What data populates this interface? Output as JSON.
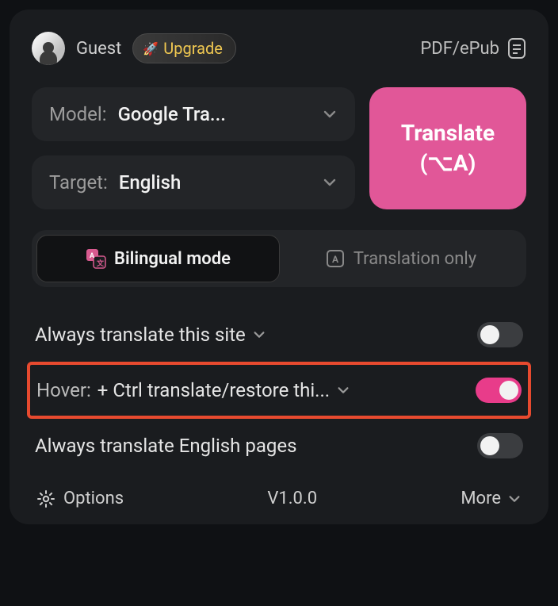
{
  "header": {
    "guest_label": "Guest",
    "upgrade_label": "Upgrade",
    "format_label": "PDF/ePub"
  },
  "model": {
    "label": "Model:",
    "value": "Google Tra..."
  },
  "target": {
    "label": "Target:",
    "value": "English"
  },
  "translate_btn": {
    "line1": "Translate",
    "line2": "(⌥A)"
  },
  "mode": {
    "bilingual": "Bilingual mode",
    "only": "Translation only",
    "active": "bilingual"
  },
  "toggles": {
    "always_site": {
      "label": "Always translate this site",
      "on": false
    },
    "hover": {
      "prefix": "Hover:",
      "label": "+ Ctrl translate/restore thi...",
      "on": true
    },
    "always_lang": {
      "label": "Always translate English pages",
      "on": false
    }
  },
  "footer": {
    "options": "Options",
    "version": "V1.0.0",
    "more": "More"
  }
}
